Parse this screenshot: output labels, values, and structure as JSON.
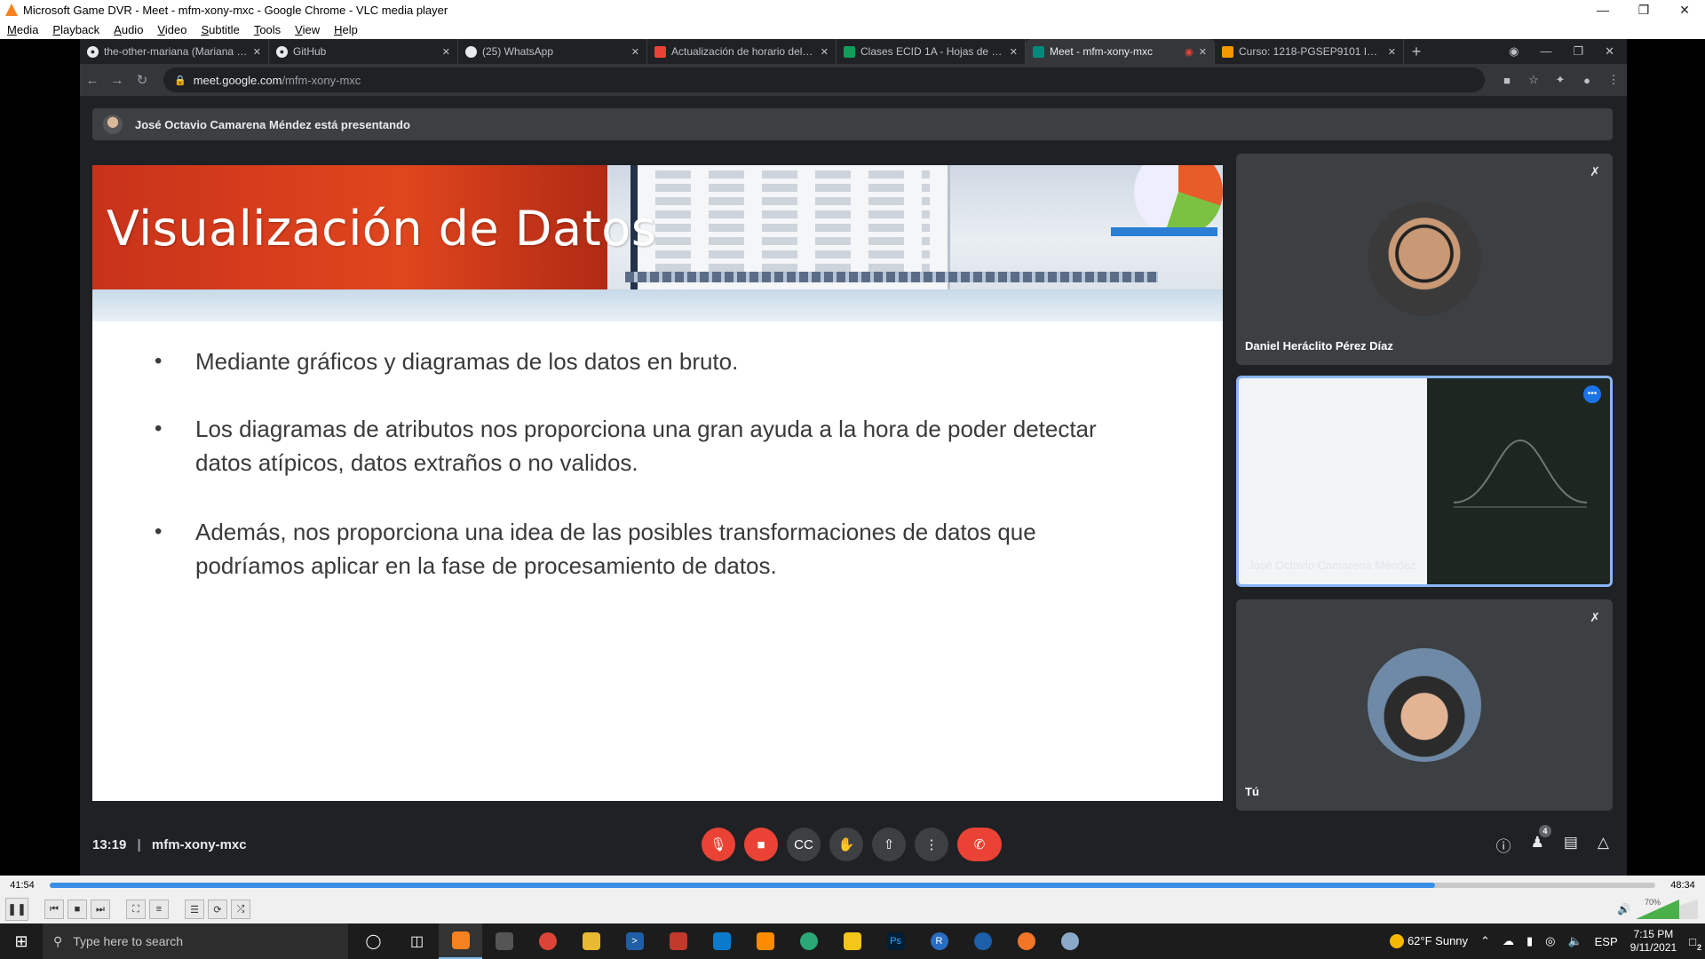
{
  "vlc": {
    "window_title": "Microsoft Game DVR - Meet - mfm-xony-mxc - Google Chrome - VLC media player",
    "menu": [
      "Media",
      "Playback",
      "Audio",
      "Video",
      "Subtitle",
      "Tools",
      "View",
      "Help"
    ],
    "elapsed": "41:54",
    "total": "48:34",
    "progress": 0.863,
    "volume_label": "70%",
    "volume": 0.7
  },
  "chrome": {
    "tabs": [
      {
        "label": "the-other-mariana (Mariana Áva",
        "icon": "github-icon",
        "active": false
      },
      {
        "label": "GitHub",
        "icon": "github-icon",
        "active": false
      },
      {
        "label": "(25) WhatsApp",
        "icon": "whatsapp-icon",
        "active": false
      },
      {
        "label": "Actualización de horario del vie",
        "icon": "gmail-icon",
        "active": false
      },
      {
        "label": "Clases ECID 1A - Hojas de cálcul",
        "icon": "sheets-icon",
        "active": false
      },
      {
        "label": "Meet - mfm-xony-mxc",
        "icon": "meet-icon",
        "active": true
      },
      {
        "label": "Curso: 1218-PGSEP9101 Introdu",
        "icon": "course-icon",
        "active": false
      }
    ],
    "url_host": "meet.google.com",
    "url_path": "/mfm-xony-mxc"
  },
  "meet": {
    "presenting_text": "José Octavio Camarena Méndez está presentando",
    "slide": {
      "title": "Visualización de Datos",
      "bullets": [
        "Mediante gráficos y diagramas de los datos en bruto.",
        "Los diagramas de atributos nos proporciona una gran ayuda a la hora de poder detectar datos atípicos, datos extraños o no validos.",
        "Además, nos proporciona una idea de las posibles transformaciones de datos que podríamos aplicar en la fase de procesamiento de datos."
      ]
    },
    "participants": [
      {
        "name": "Daniel Heráclito Pérez Díaz",
        "muted": true
      },
      {
        "name": "José Octavio Camarena Méndez",
        "speaking": true
      },
      {
        "name": "Tú",
        "muted": true
      }
    ],
    "time": "13:19",
    "meeting_code": "mfm-xony-mxc",
    "participant_count": "4"
  },
  "taskbar": {
    "search_placeholder": "Type here to search",
    "weather": "62°F  Sunny",
    "language": "ESP",
    "time": "7:15 PM",
    "date": "9/11/2021",
    "notifications": "2"
  }
}
